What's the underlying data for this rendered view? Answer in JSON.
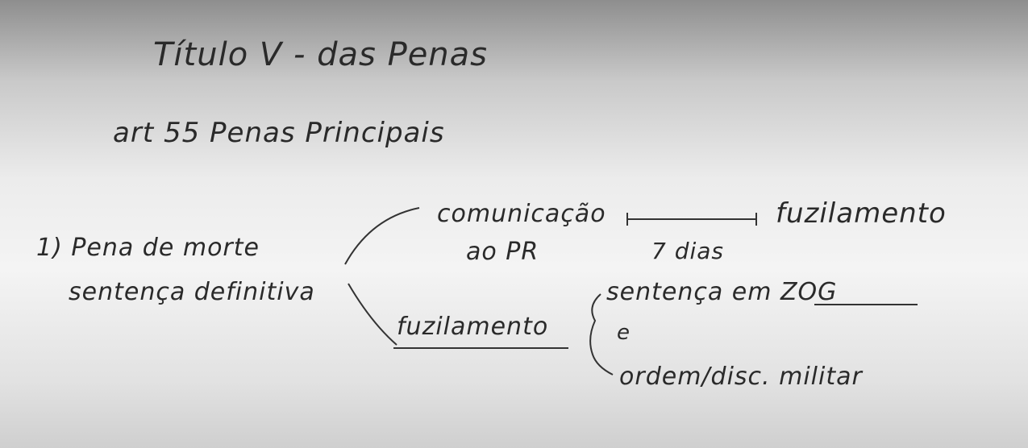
{
  "board": {
    "title": "Título V - das Penas",
    "subtitle": "art 55 Penas Principais",
    "item": "1) Pena de morte",
    "item_sub": "sentença definitiva",
    "branch_top": {
      "line1": "comunicação",
      "line2": "ao PR",
      "interval": "7 dias",
      "result": "fuzilamento"
    },
    "branch_bottom": {
      "label": "fuzilamento",
      "cond1": "sentença em ZOG",
      "joiner": "e",
      "cond2": "ordem/disc. militar"
    }
  }
}
